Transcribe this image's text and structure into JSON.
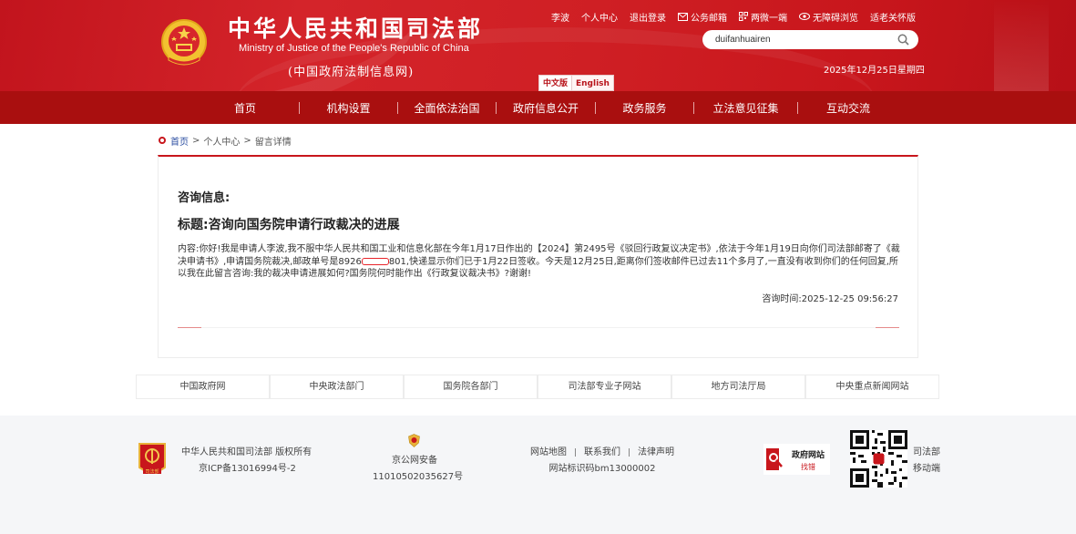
{
  "header": {
    "title_cn": "中华人民共和国司法部",
    "title_en": "Ministry of Justice of the People's Republic of China",
    "subtitle": "(中国政府法制信息网)",
    "lang_cn": "中文版",
    "lang_en": "English",
    "top_links": {
      "user": "李波",
      "personal_center": "个人中心",
      "logout": "退出登录",
      "mail": "公务邮箱",
      "weibo_weixin": "两微一端",
      "accessible": "无障碍浏览",
      "elder": "适老关怀版"
    },
    "search_value": "duifanhuairen",
    "date": "2025年12月25日星期四"
  },
  "nav": {
    "items": [
      "首页",
      "机构设置",
      "全面依法治国",
      "政府信息公开",
      "政务服务",
      "立法意见征集",
      "互动交流"
    ]
  },
  "breadcrumb": {
    "home": "首页",
    "sep": ">",
    "personal": "个人中心",
    "current": "留言详情"
  },
  "consult": {
    "label": "咨询信息:",
    "title": "标题:咨询向国务院申请行政裁决的进展",
    "content_a": "内容:你好!我是申请人李波,我不服中华人民共和国工业和信息化部在今年1月17日作出的【2024】第2495号《驳回行政复议决定书》,依法于今年1月19日向你们司法部邮寄了《裁决申请书》,申请国务院裁决,邮政单号是8926",
    "content_b": "801,快递显示你们已于1月22日签收。今天是12月25日,距离你们签收邮件已过去11个多月了,一直没有收到你们的任何回复,所以我在此留言咨询:我的裁决申请进展如何?国务院何时能作出《行政复议裁决书》?谢谢!",
    "time_label": "咨询时间:",
    "time_value": "2025-12-25 09:56:27"
  },
  "linkbar": [
    "中国政府网",
    "中央政法部门",
    "国务院各部门",
    "司法部专业子网站",
    "地方司法厅局",
    "中央重点新闻网站"
  ],
  "footer": {
    "copyright": "中华人民共和国司法部 版权所有",
    "icp": "京ICP备13016994号-2",
    "police_title": "京公网安备",
    "police_no": "11010502035627号",
    "sitemap": "网站地图",
    "contact": "联系我们",
    "legal": "法律声明",
    "site_code": "网站标识码bm13000002",
    "jiucuo_line1": "政府网站",
    "jiucuo_line2": "找错",
    "badge_text": "司法部",
    "qr_label_1": "司法部",
    "qr_label_2": "移动端"
  },
  "colors": {
    "brand_red": "#c8161c",
    "nav_red": "#a90f0f",
    "link_blue": "#2c4ea1"
  }
}
